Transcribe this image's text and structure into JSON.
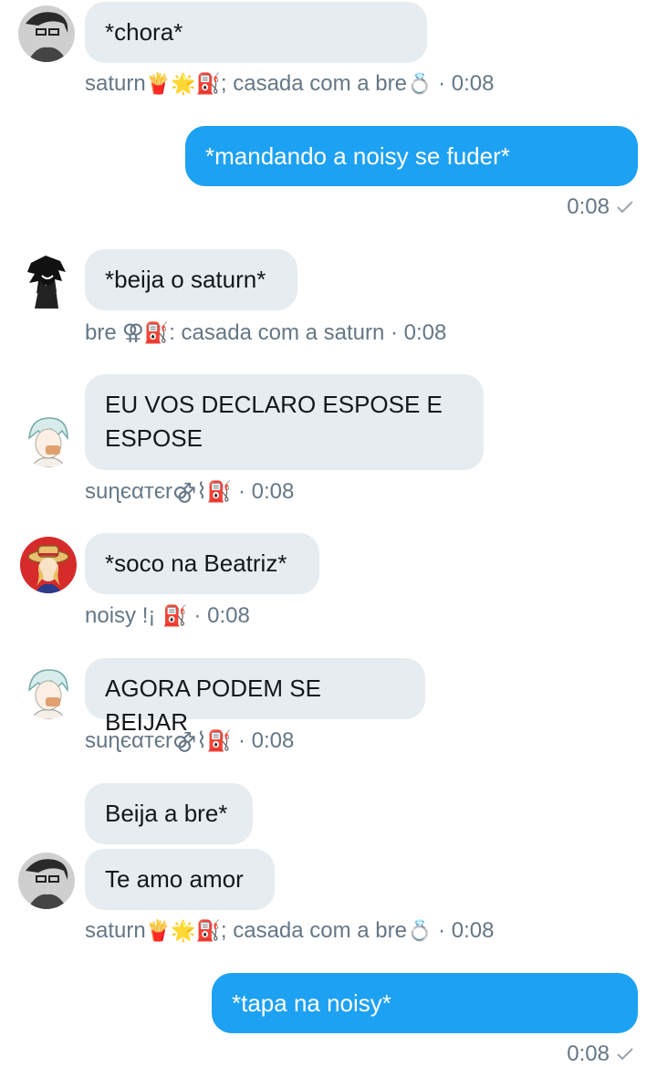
{
  "messages": [
    {
      "id": "m1",
      "text": "*chora*"
    },
    {
      "id": "m2",
      "text": "*mandando a noisy se fuder*"
    },
    {
      "id": "m3",
      "text": "*beija o saturn*"
    },
    {
      "id": "m4",
      "text": "EU VOS DECLARO ESPOSE E\nESPOSE"
    },
    {
      "id": "m5",
      "text": "*soco na Beatriz*"
    },
    {
      "id": "m6",
      "text": "AGORA PODEM SE BEIJAR"
    },
    {
      "id": "m7",
      "text": "Beija a bre*"
    },
    {
      "id": "m8",
      "text": "Te amo amor"
    },
    {
      "id": "m9",
      "text": "*tapa na noisy*"
    }
  ],
  "meta": {
    "saturn_name": "saturn",
    "saturn_emoji": "🍟🌟⛽",
    "saturn_suffix": "; casada com a bre",
    "saturn_ring": "💍",
    "bre_name": "bre",
    "bre_symbol": "⚢",
    "bre_emoji": "⛽",
    "bre_suffix": ": casada com a saturn",
    "suneater_name": "suɳєαтєr",
    "suneater_symbol": "⚣⌇",
    "suneater_emoji": "⛽",
    "noisy_name": "noisy !¡",
    "noisy_emoji": "⛽",
    "separator": " · ",
    "time": "0:08"
  },
  "colors": {
    "incoming_bubble": "#e6ecf0",
    "outgoing_bubble": "#1da1f2",
    "meta_text": "#657786"
  }
}
